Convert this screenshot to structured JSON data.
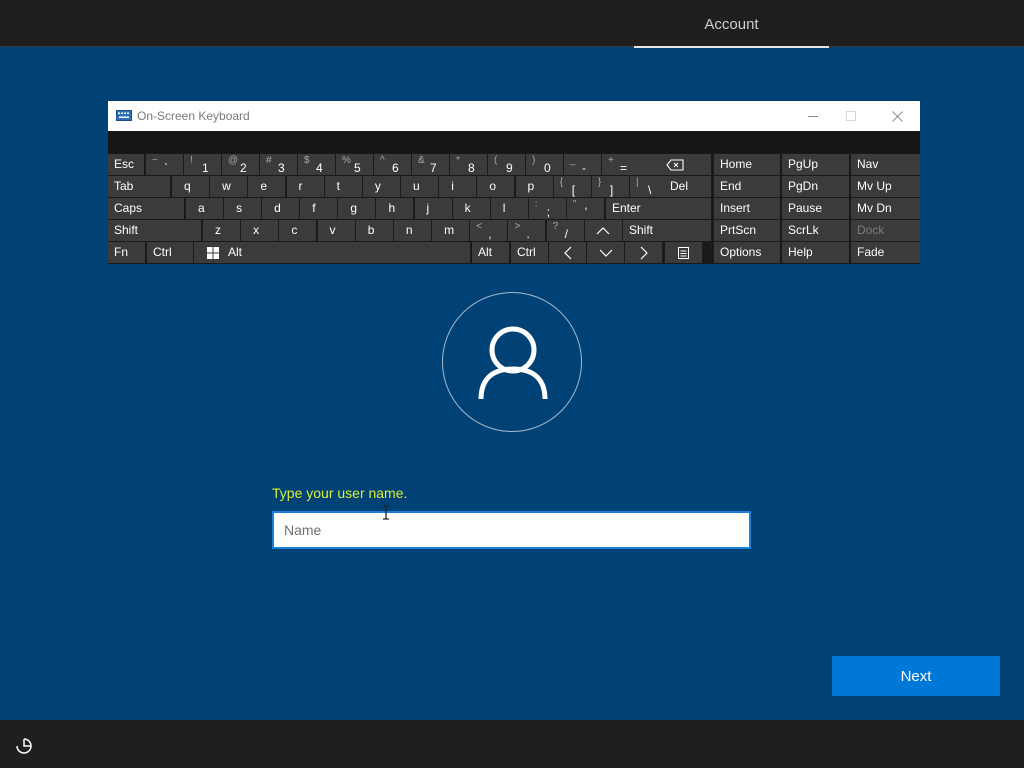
{
  "header": {
    "tab_account": "Account"
  },
  "osk": {
    "title": "On-Screen Keyboard",
    "row1": [
      {
        "label": "Esc"
      },
      {
        "sec": "~",
        "pri": "`"
      },
      {
        "sec": "!",
        "pri": "1"
      },
      {
        "sec": "@",
        "pri": "2"
      },
      {
        "sec": "#",
        "pri": "3"
      },
      {
        "sec": "$",
        "pri": "4"
      },
      {
        "sec": "%",
        "pri": "5"
      },
      {
        "sec": "^",
        "pri": "6"
      },
      {
        "sec": "&",
        "pri": "7"
      },
      {
        "sec": "*",
        "pri": "8"
      },
      {
        "sec": "(",
        "pri": "9"
      },
      {
        "sec": ")",
        "pri": "0"
      },
      {
        "sec": "_",
        "pri": "-"
      },
      {
        "sec": "+",
        "pri": "="
      },
      {
        "icon": "backspace-icon"
      }
    ],
    "row2": [
      {
        "label": "Tab"
      },
      {
        "label": "q"
      },
      {
        "label": "w"
      },
      {
        "label": "e"
      },
      {
        "label": "r"
      },
      {
        "label": "t"
      },
      {
        "label": "y"
      },
      {
        "label": "u"
      },
      {
        "label": "i"
      },
      {
        "label": "o"
      },
      {
        "label": "p"
      },
      {
        "sec": "{",
        "pri": "["
      },
      {
        "sec": "}",
        "pri": "]"
      },
      {
        "sec": "|",
        "pri": "\\"
      },
      {
        "label": "Del"
      }
    ],
    "row3": [
      {
        "label": "Caps"
      },
      {
        "label": "a"
      },
      {
        "label": "s"
      },
      {
        "label": "d"
      },
      {
        "label": "f"
      },
      {
        "label": "g"
      },
      {
        "label": "h"
      },
      {
        "label": "j"
      },
      {
        "label": "k"
      },
      {
        "label": "l"
      },
      {
        "sec": ":",
        "pri": ";"
      },
      {
        "sec": "\"",
        "pri": "'"
      },
      {
        "label": "Enter"
      }
    ],
    "row4": [
      {
        "label": "Shift"
      },
      {
        "label": "z"
      },
      {
        "label": "x"
      },
      {
        "label": "c"
      },
      {
        "label": "v"
      },
      {
        "label": "b"
      },
      {
        "label": "n"
      },
      {
        "label": "m"
      },
      {
        "sec": "<",
        "pri": ","
      },
      {
        "sec": ">",
        "pri": "."
      },
      {
        "sec": "?",
        "pri": "/"
      },
      {
        "icon": "arrow-up-icon"
      },
      {
        "label": "Shift"
      }
    ],
    "row5": [
      {
        "label": "Fn"
      },
      {
        "label": "Ctrl"
      },
      {
        "icon": "windows-icon"
      },
      {
        "label": "Alt"
      },
      {
        "label": ""
      },
      {
        "label": "Alt"
      },
      {
        "label": "Ctrl"
      },
      {
        "icon": "arrow-left-icon"
      },
      {
        "icon": "arrow-down-icon"
      },
      {
        "icon": "arrow-right-icon"
      },
      {
        "icon": "menu-icon"
      }
    ],
    "nav_keys": [
      [
        "Home",
        "PgUp",
        "Nav"
      ],
      [
        "End",
        "PgDn",
        "Mv Up"
      ],
      [
        "Insert",
        "Pause",
        "Mv Dn"
      ],
      [
        "PrtScn",
        "ScrLk",
        "Dock"
      ],
      [
        "Options",
        "Help",
        "Fade"
      ]
    ]
  },
  "form": {
    "prompt": "Type your user name.",
    "name_placeholder": "Name",
    "name_value": ""
  },
  "next_button": "Next",
  "colors": {
    "background": "#004275",
    "accent": "#0078d7",
    "prompt": "#d8f036",
    "key": "#3b3b3b"
  }
}
